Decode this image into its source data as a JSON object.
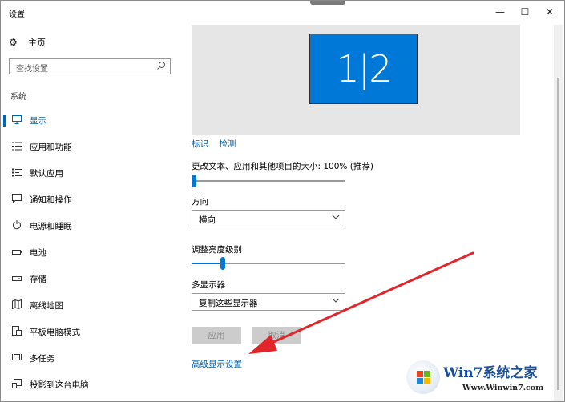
{
  "window": {
    "title": "设置",
    "minimize": "—",
    "maximize": "☐",
    "close": "✕"
  },
  "sidebar": {
    "home_label": "主页",
    "home_icon": "gear-icon",
    "search_placeholder": "查找设置",
    "section_label": "系统",
    "items": [
      {
        "label": "显示",
        "icon": "monitor-icon",
        "active": true
      },
      {
        "label": "应用和功能",
        "icon": "list-icon"
      },
      {
        "label": "默认应用",
        "icon": "default-apps-icon"
      },
      {
        "label": "通知和操作",
        "icon": "notification-icon"
      },
      {
        "label": "电源和睡眠",
        "icon": "power-icon"
      },
      {
        "label": "电池",
        "icon": "battery-icon"
      },
      {
        "label": "存储",
        "icon": "storage-icon"
      },
      {
        "label": "离线地图",
        "icon": "map-icon"
      },
      {
        "label": "平板电脑模式",
        "icon": "tablet-icon"
      },
      {
        "label": "多任务",
        "icon": "multitask-icon"
      },
      {
        "label": "投影到这台电脑",
        "icon": "project-icon"
      }
    ]
  },
  "main": {
    "monitor_label": "1|2",
    "identify_link": "标识",
    "detect_link": "检测",
    "scale_label": "更改文本、应用和其他项目的大小: 100% (推荐)",
    "scale_slider_value": 0,
    "orientation_label": "方向",
    "orientation_value": "横向",
    "brightness_label": "调整亮度级别",
    "brightness_value": 0.2,
    "multi_display_label": "多显示器",
    "multi_display_value": "复制这些显示器",
    "apply_button": "应用",
    "cancel_button": "取消",
    "advanced_link": "高级显示设置"
  },
  "watermark": {
    "title": "Win7系统之家",
    "url": "Www.Winwin7.com"
  },
  "colors": {
    "accent": "#0078d7",
    "link": "#0063b1",
    "annotation_arrow": "#e0262b"
  }
}
